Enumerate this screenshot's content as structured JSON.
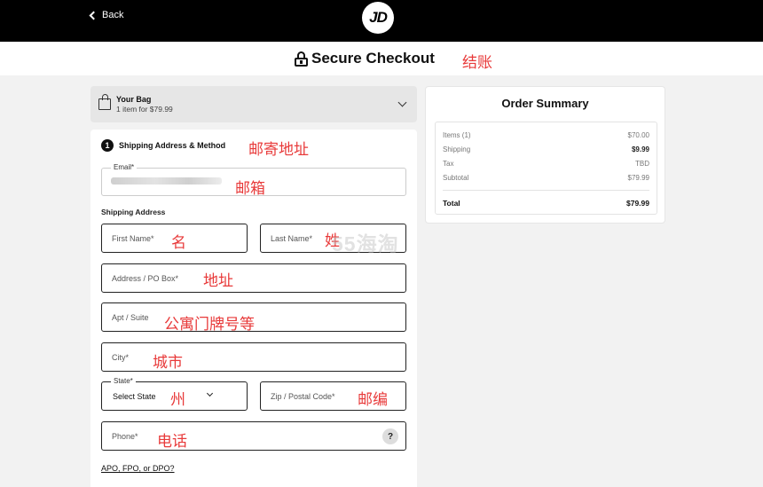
{
  "header": {
    "back_label": "Back",
    "logo_text": "JD"
  },
  "titlebar": {
    "title": "Secure Checkout",
    "annotation": "结账"
  },
  "bag": {
    "title": "Your Bag",
    "subtitle": "1 item for $79.99"
  },
  "form": {
    "step_number": "1",
    "step_title": "Shipping Address & Method",
    "step_annotation": "邮寄地址",
    "email": {
      "label": "Email*",
      "annotation": "邮箱"
    },
    "shipping_label": "Shipping Address",
    "first_name": {
      "placeholder": "First Name*",
      "annotation": "名"
    },
    "last_name": {
      "placeholder": "Last Name*",
      "annotation": "姓"
    },
    "address": {
      "placeholder": "Address / PO Box*",
      "annotation": "地址"
    },
    "apt": {
      "placeholder": "Apt / Suite",
      "annotation": "公寓门牌号等"
    },
    "city": {
      "placeholder": "City*",
      "annotation": "城市"
    },
    "state": {
      "label": "State*",
      "value": "Select State",
      "annotation": "州"
    },
    "zip": {
      "placeholder": "Zip / Postal Code*",
      "annotation": "邮编"
    },
    "phone": {
      "placeholder": "Phone*",
      "annotation": "电话",
      "help": "?"
    },
    "apo_link": "APO, FPO, or DPO?"
  },
  "summary": {
    "title": "Order Summary",
    "rows": [
      {
        "label": "Items (1)",
        "value": "$70.00"
      },
      {
        "label": "Shipping",
        "value": "$9.99"
      },
      {
        "label": "Tax",
        "value": "TBD"
      },
      {
        "label": "Subtotal",
        "value": "$79.99"
      }
    ],
    "total": {
      "label": "Total",
      "value": "$79.99"
    }
  },
  "watermark": "55海淘",
  "colors": {
    "annotation": "#e83a3a",
    "header_bg": "#000000",
    "page_bg": "#f2f2f2"
  }
}
